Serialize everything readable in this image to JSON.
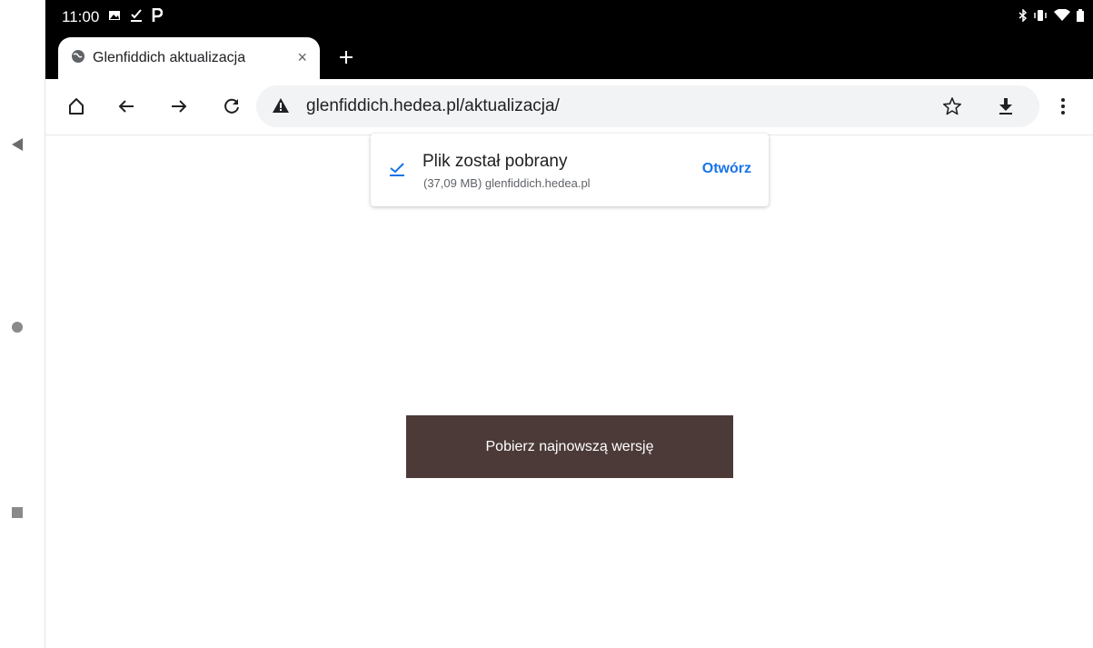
{
  "status_bar": {
    "time": "11:00"
  },
  "tab": {
    "title": "Glenfiddich aktualizacja",
    "close_symbol": "×"
  },
  "toolbar": {
    "url": "glenfiddich.hedea.pl/aktualizacja/"
  },
  "download": {
    "title": "Plik został pobrany",
    "subtitle": "(37,09 MB) glenfiddich.hedea.pl",
    "open_label": "Otwórz"
  },
  "page": {
    "download_button_label": "Pobierz najnowszą wersję"
  },
  "colors": {
    "cta_bg": "#4b3a37",
    "link_blue": "#1a73e8",
    "chrome_black": "#000000"
  },
  "icons": [
    "image-icon",
    "download-done-icon",
    "parking-icon",
    "bluetooth-icon",
    "vibrate-icon",
    "wifi-icon",
    "battery-icon",
    "globe-icon",
    "close-icon",
    "plus-icon",
    "home-icon",
    "back-arrow-icon",
    "forward-arrow-icon",
    "reload-icon",
    "warning-icon",
    "star-icon",
    "download-icon",
    "more-vert-icon",
    "checkmark-icon",
    "nav-back-icon",
    "nav-home-icon",
    "nav-recents-icon"
  ]
}
